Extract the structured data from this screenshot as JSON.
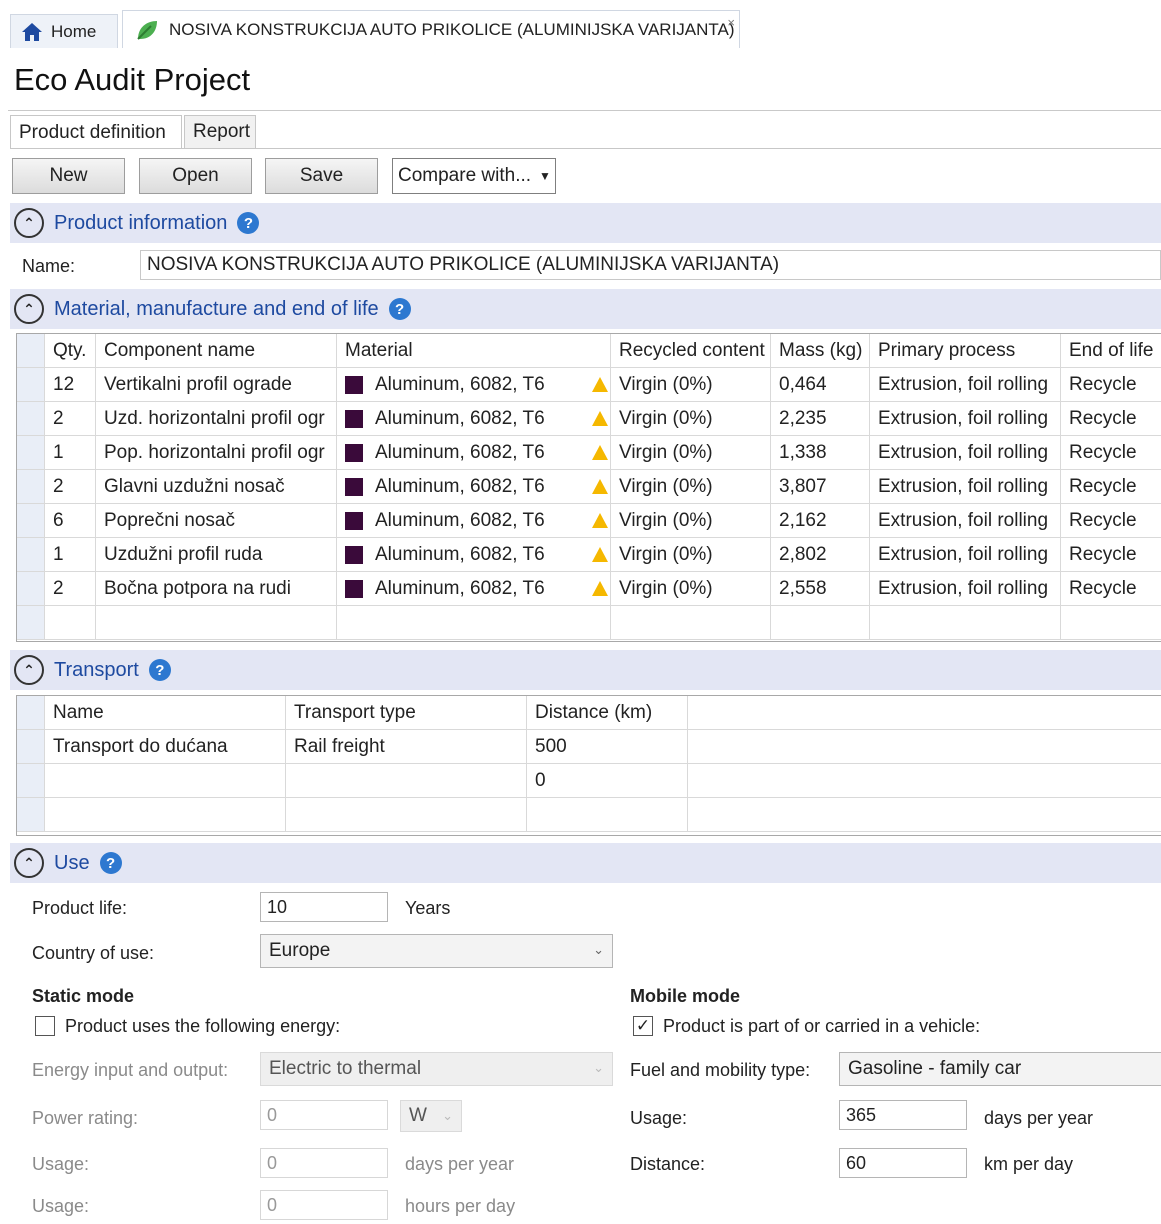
{
  "tabs": {
    "home": "Home",
    "document": "NOSIVA KONSTRUKCIJA AUTO PRIKOLICE (ALUMINIJSKA VARIJANTA)",
    "close": "×"
  },
  "page_title": "Eco Audit Project",
  "subtabs": [
    "Product definition",
    "Report"
  ],
  "toolbar": {
    "new": "New",
    "open": "Open",
    "save": "Save",
    "compare": "Compare with..."
  },
  "product_info": {
    "header": "Product information",
    "name_label": "Name:",
    "name_value": "NOSIVA KONSTRUKCIJA AUTO PRIKOLICE (ALUMINIJSKA VARIJANTA)"
  },
  "materials": {
    "header": "Material, manufacture and end of life",
    "columns": [
      "Qty.",
      "Component name",
      "Material",
      "Recycled content",
      "Mass (kg)",
      "Primary process",
      "End of life"
    ],
    "rows": [
      {
        "qty": "12",
        "name": "Vertikalni profil ograde",
        "material": "Aluminum, 6082, T6",
        "recycled": "Virgin (0%)",
        "mass": "0,464",
        "process": "Extrusion, foil rolling",
        "eol": "Recycle"
      },
      {
        "qty": "2",
        "name": "Uzd. horizontalni profil ogr",
        "material": "Aluminum, 6082, T6",
        "recycled": "Virgin (0%)",
        "mass": "2,235",
        "process": "Extrusion, foil rolling",
        "eol": "Recycle"
      },
      {
        "qty": "1",
        "name": "Pop. horizontalni profil ogr",
        "material": "Aluminum, 6082, T6",
        "recycled": "Virgin (0%)",
        "mass": "1,338",
        "process": "Extrusion, foil rolling",
        "eol": "Recycle"
      },
      {
        "qty": "2",
        "name": "Glavni uzdužni nosač",
        "material": "Aluminum, 6082, T6",
        "recycled": "Virgin (0%)",
        "mass": "3,807",
        "process": "Extrusion, foil rolling",
        "eol": "Recycle"
      },
      {
        "qty": "6",
        "name": "Poprečni nosač",
        "material": "Aluminum, 6082, T6",
        "recycled": "Virgin (0%)",
        "mass": "2,162",
        "process": "Extrusion, foil rolling",
        "eol": "Recycle"
      },
      {
        "qty": "1",
        "name": "Uzdužni profil ruda",
        "material": "Aluminum, 6082, T6",
        "recycled": "Virgin (0%)",
        "mass": "2,802",
        "process": "Extrusion, foil rolling",
        "eol": "Recycle"
      },
      {
        "qty": "2",
        "name": "Bočna potpora na rudi",
        "material": "Aluminum, 6082, T6",
        "recycled": "Virgin (0%)",
        "mass": "2,558",
        "process": "Extrusion, foil rolling",
        "eol": "Recycle"
      }
    ],
    "material_color": "#3a0a3a",
    "warning_icon": "warning-triangle-icon"
  },
  "transport": {
    "header": "Transport",
    "columns": [
      "Name",
      "Transport type",
      "Distance (km)"
    ],
    "rows": [
      {
        "name": "Transport do dućana",
        "type": "Rail freight",
        "distance": "500"
      },
      {
        "name": "",
        "type": "",
        "distance": "0"
      }
    ]
  },
  "use": {
    "header": "Use",
    "product_life_label": "Product life:",
    "product_life_value": "10",
    "product_life_unit": "Years",
    "country_label": "Country of use:",
    "country_value": "Europe",
    "static": {
      "title": "Static mode",
      "checkbox_label": "Product uses the following energy:",
      "checked": false,
      "energy_label": "Energy input and output:",
      "energy_value": "Electric to thermal",
      "power_label": "Power rating:",
      "power_value": "0",
      "power_unit": "W",
      "usage_days_label": "Usage:",
      "usage_days_value": "0",
      "usage_days_unit": "days per year",
      "usage_hours_label": "Usage:",
      "usage_hours_value": "0",
      "usage_hours_unit": "hours per day"
    },
    "mobile": {
      "title": "Mobile mode",
      "checkbox_label": "Product is part of or carried in a vehicle:",
      "checked": true,
      "check_mark": "✓",
      "fuel_label": "Fuel and mobility type:",
      "fuel_value": "Gasoline - family car",
      "usage_label": "Usage:",
      "usage_value": "365",
      "usage_unit": "days per year",
      "distance_label": "Distance:",
      "distance_value": "60",
      "distance_unit": "km per day"
    }
  },
  "colors": {
    "section_bg": "#e3e6f4",
    "section_text": "#1e4aa0",
    "help_blue": "#2d78d0",
    "warning": "#f5b800"
  }
}
